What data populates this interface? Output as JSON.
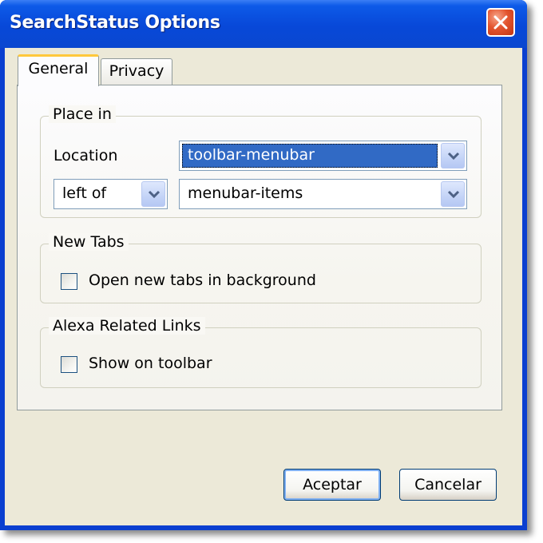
{
  "window": {
    "title": "SearchStatus Options"
  },
  "tabs": [
    {
      "label": "General",
      "active": true
    },
    {
      "label": "Privacy",
      "active": false
    }
  ],
  "place_in": {
    "legend": "Place in",
    "location_label": "Location",
    "location_value": "toolbar-menubar",
    "position_value": "left of",
    "anchor_value": "menubar-items"
  },
  "new_tabs": {
    "legend": "New Tabs",
    "checkbox_label": "Open new tabs in background",
    "checked": false
  },
  "alexa": {
    "legend": "Alexa Related Links",
    "checkbox_label": "Show on toolbar",
    "checked": false
  },
  "buttons": {
    "ok_label": "Aceptar",
    "cancel_label": "Cancelar"
  },
  "colors": {
    "titlebar": "#0a47d0",
    "client_bg": "#ece9d8",
    "selection": "#316ac5",
    "close_button": "#e3552f"
  },
  "icons": {
    "close": "close-icon",
    "dropdown": "chevron-down-icon"
  }
}
